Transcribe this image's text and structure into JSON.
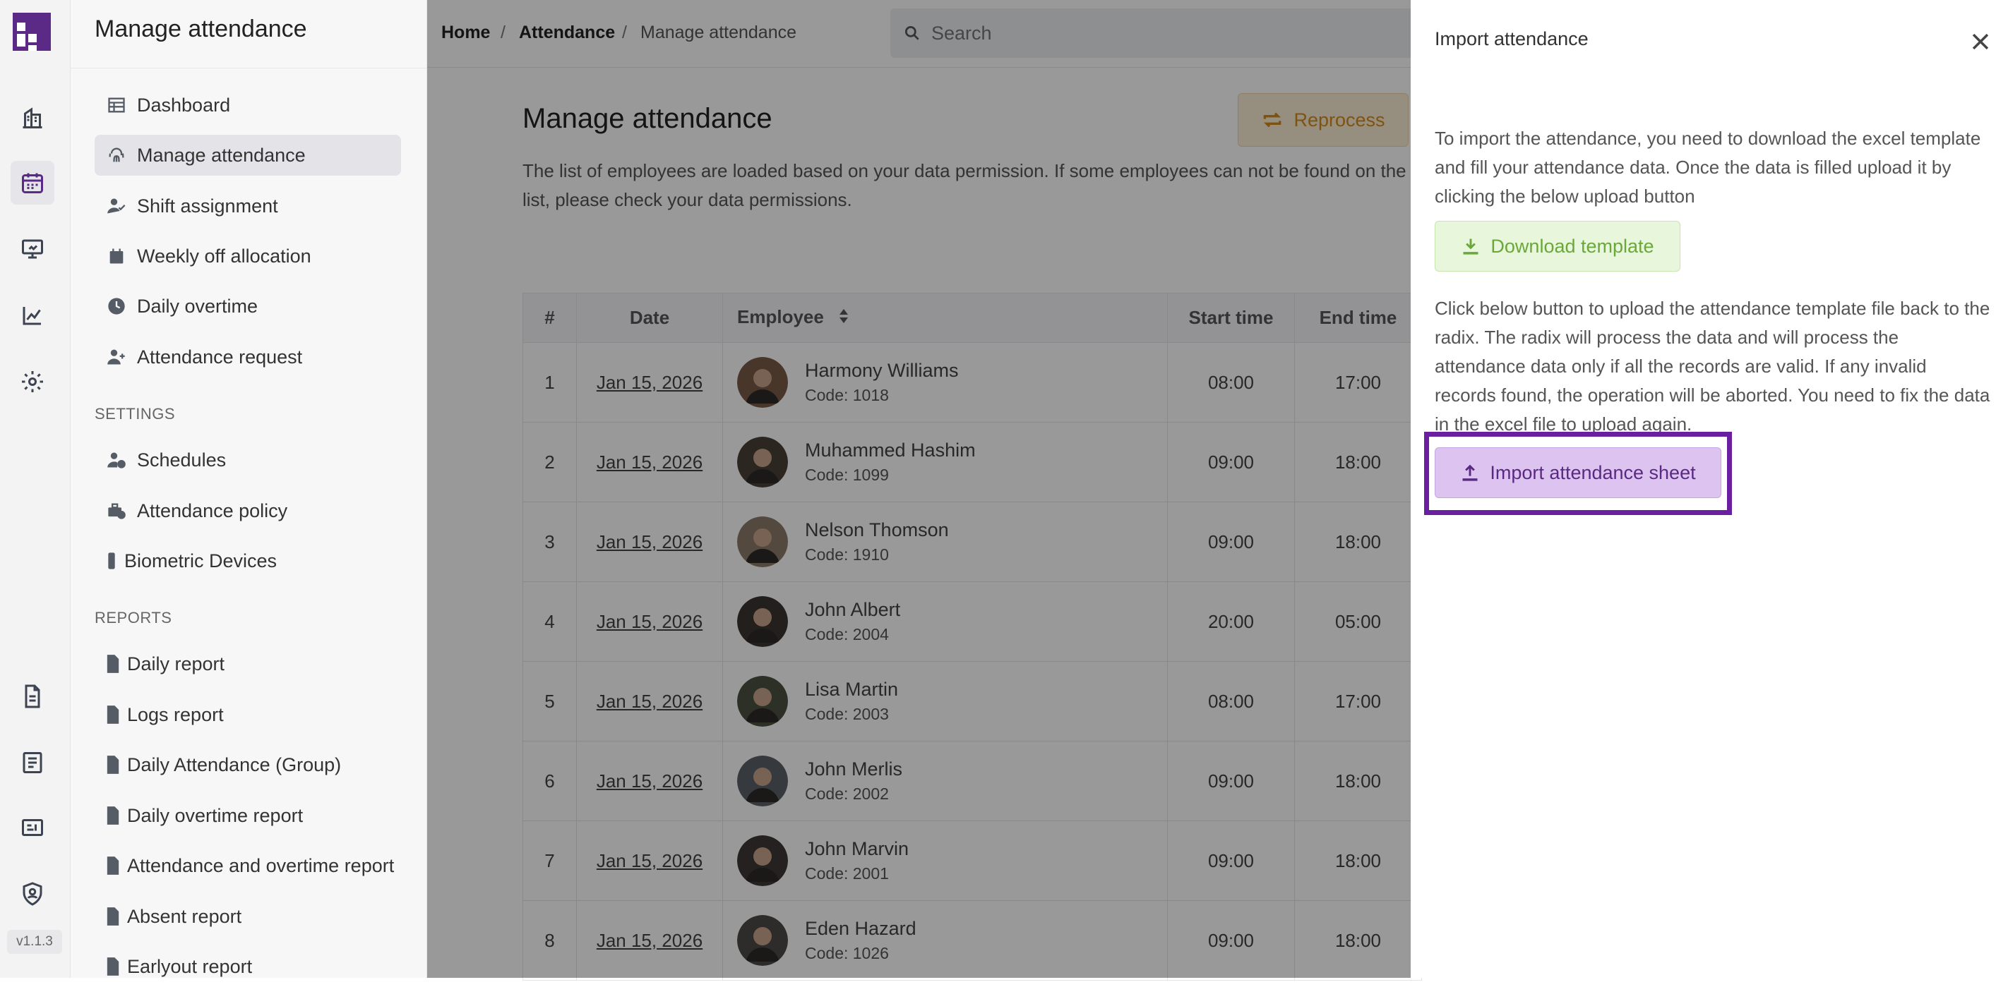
{
  "rail": {
    "version": "v1.1.3",
    "icons": [
      "logo-icon",
      "building-icon",
      "calendar-icon",
      "presentation-icon",
      "chart-icon",
      "gear-icon",
      "document-icon",
      "list-icon",
      "id-card-icon",
      "shield-icon"
    ]
  },
  "sidebar": {
    "title": "Manage attendance",
    "items": [
      {
        "label": "Dashboard",
        "icon": "table-icon"
      },
      {
        "label": "Manage attendance",
        "icon": "fingerprint-icon",
        "active": true
      },
      {
        "label": "Shift assignment",
        "icon": "user-check-icon"
      },
      {
        "label": "Weekly off allocation",
        "icon": "calendar-icon"
      },
      {
        "label": "Daily overtime",
        "icon": "clock-icon"
      },
      {
        "label": "Attendance request",
        "icon": "user-plus-icon"
      }
    ],
    "settings_label": "SETTINGS",
    "settings_items": [
      {
        "label": "Schedules",
        "icon": "user-clock-icon"
      },
      {
        "label": "Attendance policy",
        "icon": "business-time-icon"
      },
      {
        "label": "Biometric Devices",
        "icon": "device-icon"
      }
    ],
    "reports_label": "REPORTS",
    "report_items": [
      {
        "label": "Daily report"
      },
      {
        "label": "Logs report"
      },
      {
        "label": "Daily Attendance (Group)"
      },
      {
        "label": "Daily overtime report"
      },
      {
        "label": "Attendance and overtime report"
      },
      {
        "label": "Absent report"
      },
      {
        "label": "Earlyout report"
      }
    ]
  },
  "breadcrumb": {
    "home": "Home",
    "sep": "/",
    "section": "Attendance",
    "current": "Manage attendance"
  },
  "search": {
    "placeholder": "Search"
  },
  "main": {
    "title": "Manage attendance",
    "description": "The list of employees are loaded based on your data permission. If some employees can not be found on the list, please check your data permissions.",
    "reprocess_label": "Reprocess"
  },
  "table": {
    "columns": [
      "#",
      "Date",
      "Employee",
      "Start time",
      "End time"
    ],
    "code_prefix": "Code: ",
    "rows": [
      {
        "n": "1",
        "date": "Jan 15, 2026",
        "name": "Harmony Williams",
        "code": "1018",
        "start": "08:00",
        "end": "17:00"
      },
      {
        "n": "2",
        "date": "Jan 15, 2026",
        "name": "Muhammed Hashim",
        "code": "1099",
        "start": "09:00",
        "end": "18:00"
      },
      {
        "n": "3",
        "date": "Jan 15, 2026",
        "name": "Nelson Thomson",
        "code": "1910",
        "start": "09:00",
        "end": "18:00"
      },
      {
        "n": "4",
        "date": "Jan 15, 2026",
        "name": "John Albert",
        "code": "2004",
        "start": "20:00",
        "end": "05:00"
      },
      {
        "n": "5",
        "date": "Jan 15, 2026",
        "name": "Lisa Martin",
        "code": "2003",
        "start": "08:00",
        "end": "17:00"
      },
      {
        "n": "6",
        "date": "Jan 15, 2026",
        "name": "John Merlis",
        "code": "2002",
        "start": "09:00",
        "end": "18:00"
      },
      {
        "n": "7",
        "date": "Jan 15, 2026",
        "name": "John Marvin",
        "code": "2001",
        "start": "09:00",
        "end": "18:00"
      },
      {
        "n": "8",
        "date": "Jan 15, 2026",
        "name": "Eden Hazard",
        "code": "1026",
        "start": "09:00",
        "end": "18:00"
      }
    ]
  },
  "drawer": {
    "title": "Import attendance",
    "para1": "To import the attendance, you need to download the excel template and fill your attendance data. Once the data is filled upload it by clicking the below upload button",
    "download_label": "Download template",
    "para2": "Click below button to upload the attendance template file back to the radix. The radix will process the data and will process the attendance data only if all the records are valid. If any invalid records found, the operation will be aborted. You need to fix the data in the excel file to upload again.",
    "import_label": "Import attendance sheet"
  },
  "colors": {
    "brand": "#5b2a86",
    "highlight_frame": "#6a1fa0",
    "download_bg": "#e8f6dc",
    "download_text": "#6aa83a",
    "import_bg": "#dcc3f0",
    "reprocess_bg": "#fbeed6",
    "reprocess_text": "#d48b19"
  }
}
